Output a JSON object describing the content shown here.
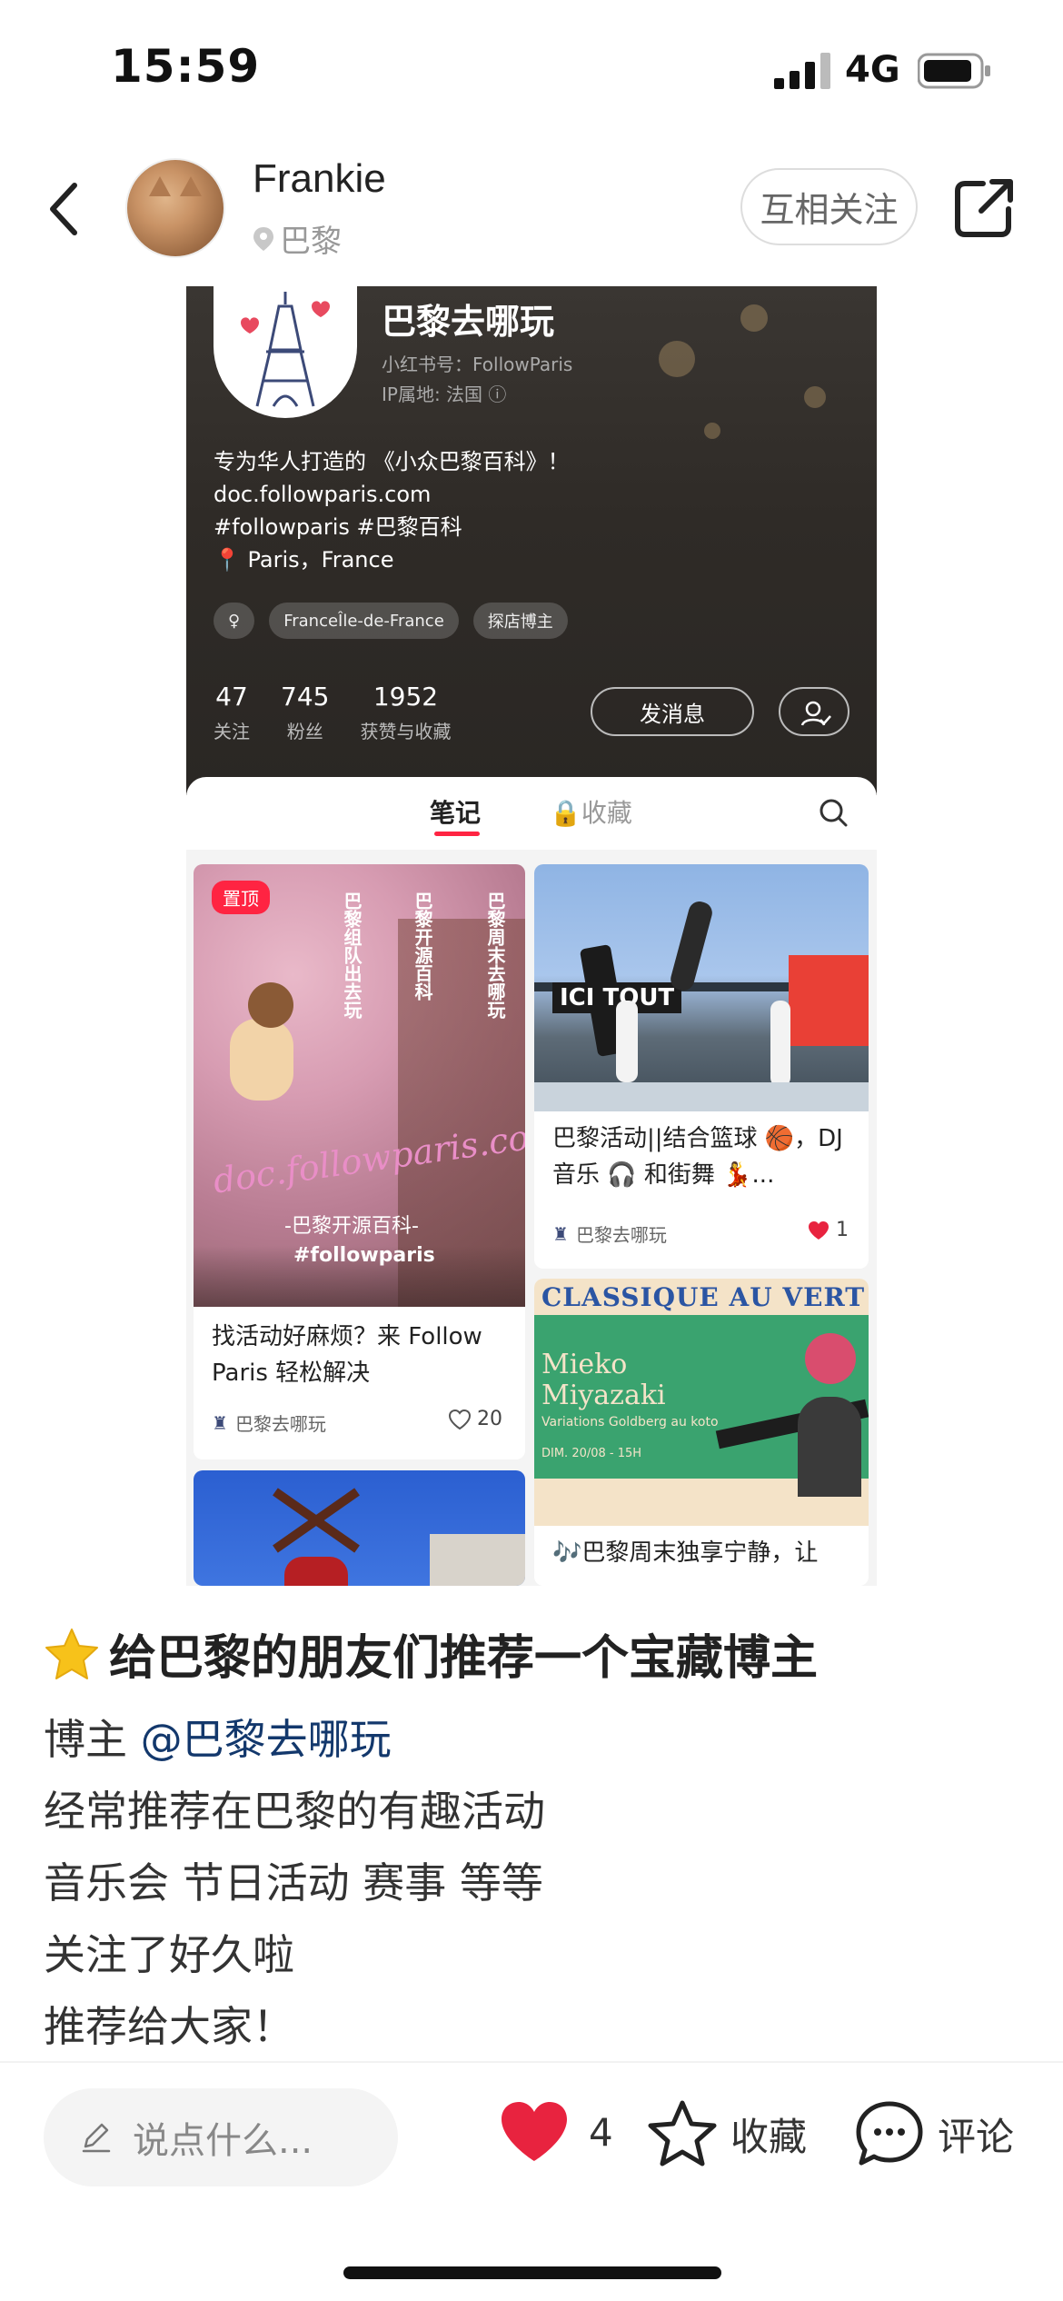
{
  "status_bar": {
    "time": "15:59",
    "network": "4G"
  },
  "header": {
    "username": "Frankie",
    "location": "巴黎",
    "follow_label": "互相关注"
  },
  "post_image": {
    "profile": {
      "name": "巴黎去哪玩",
      "id_text": "小红书号：FollowParis",
      "ip_text": "IP属地: 法国 ⓘ",
      "bio_lines": [
        "专为华人打造的 《小众巴黎百科》！",
        "doc.followparis.com",
        "#followparis #巴黎百科",
        "📍 Paris，France"
      ],
      "tags": [
        "♀",
        "FranceÎle-de-France",
        "探店博主"
      ],
      "stats": [
        {
          "num": "47",
          "label": "关注"
        },
        {
          "num": "745",
          "label": "粉丝"
        },
        {
          "num": "1952",
          "label": "获赞与收藏"
        }
      ],
      "message_label": "发消息",
      "tab_notes": "笔记",
      "tab_favorites": "🔒收藏"
    },
    "cards": {
      "card1": {
        "pinned": "置顶",
        "overlay_lines": [
          "巴黎周末去哪玩",
          "巴黎开源百科",
          "巴黎组队出去玩"
        ],
        "overlay_url": "doc.followparis.com",
        "overlay_sub": "-巴黎开源百科-",
        "overlay_tag": "#followparis",
        "title": "找活动好麻烦？来 Follow Paris 轻松解决",
        "author": "巴黎去哪玩",
        "likes": "20"
      },
      "card2": {
        "title": "巴黎活动||结合篮球 🏀，DJ 音乐 🎧 和街舞 💃...",
        "author": "巴黎去哪玩",
        "likes": "1",
        "sign_text": "ICI TOUT"
      },
      "card3": {
        "poster_title": "CLASSIQUE AU VERT",
        "poster_name": "Mieko Miyazaki",
        "poster_sub": "Variations Goldberg au koto",
        "poster_date": "DIM. 20/08 - 15H",
        "title_partial": "🎶巴黎周末独享宁静，让"
      }
    }
  },
  "post": {
    "title": "给巴黎的朋友们推荐一个宝藏博主",
    "body_prefix": "博主 ",
    "mention": "@巴黎去哪玩",
    "lines": [
      "经常推荐在巴黎的有趣活动",
      "音乐会 节日活动 赛事 等等",
      "关注了好久啦",
      "推荐给大家！"
    ]
  },
  "bottom_bar": {
    "comment_placeholder": "说点什么...",
    "like_count": "4",
    "favorite_label": "收藏",
    "comment_label": "评论"
  },
  "colors": {
    "accent": "#ff2442",
    "mention": "#13386c"
  },
  "icons": [
    "back-arrow-icon",
    "location-pin-icon",
    "share-icon",
    "search-icon",
    "heart-icon",
    "star-icon",
    "comment-bubble-icon",
    "pencil-icon"
  ]
}
